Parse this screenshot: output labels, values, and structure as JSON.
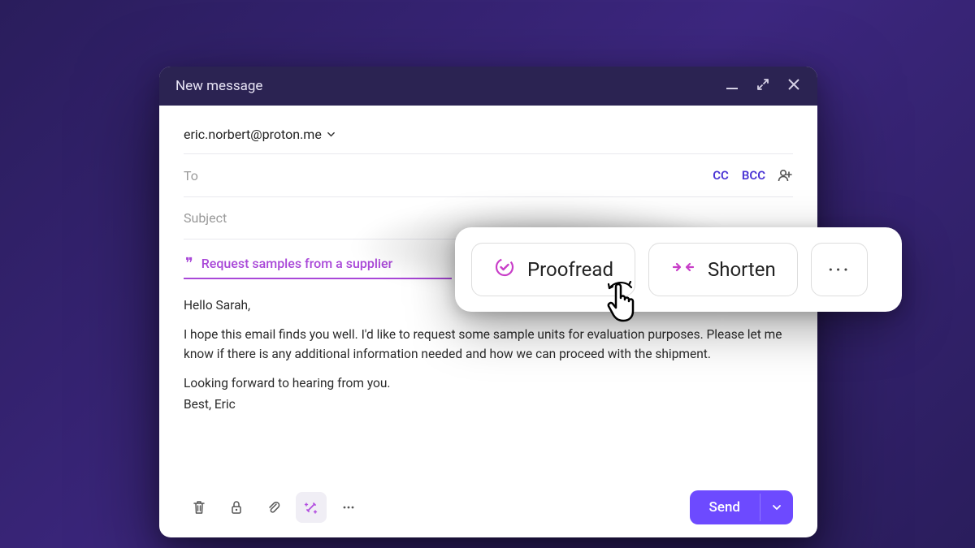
{
  "window": {
    "title": "New message"
  },
  "from": {
    "email": "eric.norbert@proton.me"
  },
  "to": {
    "placeholder": "To",
    "cc": "CC",
    "bcc": "BCC"
  },
  "subject": {
    "placeholder": "Subject"
  },
  "suggestion": {
    "text": "Request samples from a supplier"
  },
  "body": {
    "greeting": "Hello Sarah,",
    "para1": "I hope this email finds you well. I'd like to request some sample units for evaluation purposes. Please let me know if there is any additional information needed and how we can proceed with the shipment.",
    "para2": "Looking forward to hearing from you.",
    "signoff": "Best, Eric"
  },
  "toolbar": {
    "send": "Send"
  },
  "ai": {
    "proofread": "Proofread",
    "shorten": "Shorten",
    "more": "···"
  },
  "colors": {
    "accent": "#6d4aff",
    "magenta": "#a948d8",
    "titlebar": "#2b2352"
  }
}
